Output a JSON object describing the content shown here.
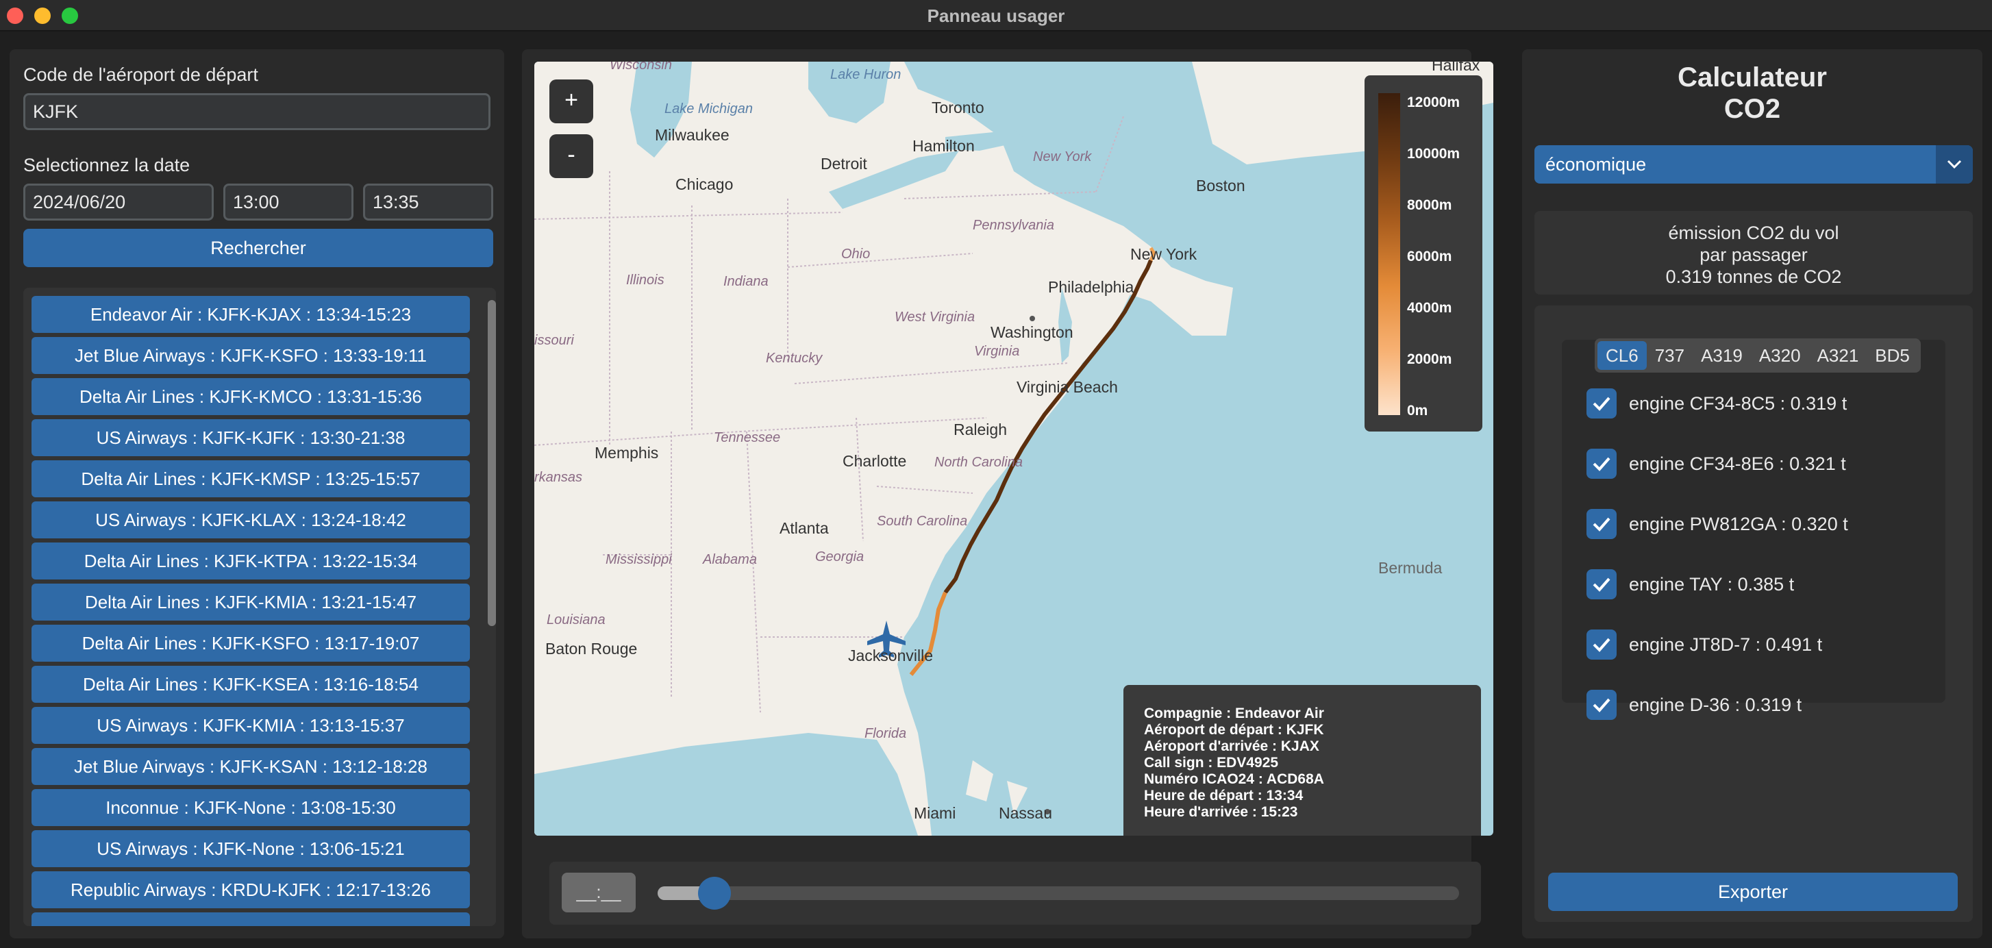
{
  "window": {
    "title": "Panneau usager"
  },
  "search": {
    "airport_label": "Code de l'aéroport de départ",
    "airport_value": "KJFK",
    "date_label": "Selectionnez la date",
    "date_value": "2024/06/20",
    "time_start": "13:00",
    "time_end": "13:35",
    "search_button": "Rechercher"
  },
  "flights": [
    "Endeavor Air : KJFK-KJAX : 13:34-15:23",
    "Jet Blue Airways : KJFK-KSFO : 13:33-19:11",
    "Delta Air Lines : KJFK-KMCO : 13:31-15:36",
    "US Airways : KJFK-KJFK : 13:30-21:38",
    "Delta Air Lines : KJFK-KMSP : 13:25-15:57",
    "US Airways : KJFK-KLAX : 13:24-18:42",
    "Delta Air Lines : KJFK-KTPA : 13:22-15:34",
    "Delta Air Lines : KJFK-KMIA : 13:21-15:47",
    "Delta Air Lines : KJFK-KSFO : 13:17-19:07",
    "Delta Air Lines : KJFK-KSEA : 13:16-18:54",
    "US Airways : KJFK-KMIA : 13:13-15:37",
    "Jet Blue Airways : KJFK-KSAN : 13:12-18:28",
    "Inconnue : KJFK-None : 13:08-15:30",
    "US Airways : KJFK-None : 13:06-15:21",
    "Republic Airways : KRDU-KJFK : 12:17-13:26"
  ],
  "map": {
    "zoom_in": "+",
    "zoom_out": "-",
    "legend": [
      "12000m",
      "10000m",
      "8000m",
      "6000m",
      "4000m",
      "2000m",
      "0m"
    ],
    "labels": {
      "wisconsin": "Wisconsin",
      "lake_michigan": "Lake Michigan",
      "lake_huron": "Lake Huron",
      "toronto": "Toronto",
      "milwaukee": "Milwaukee",
      "hamilton": "Hamilton",
      "detroit": "Detroit",
      "new_york_state": "New York",
      "chicago": "Chicago",
      "boston": "Boston",
      "halifax": "Halifax",
      "pennsylvania": "Pennsylvania",
      "new_york": "New York",
      "ohio": "Ohio",
      "illinois": "Illinois",
      "indiana": "Indiana",
      "philadelphia": "Philadelphia",
      "west_virginia": "West Virginia",
      "washington": "Washington",
      "issouri": "issouri",
      "kentucky": "Kentucky",
      "virginia": "Virginia",
      "virginia_beach": "Virginia Beach",
      "raleigh": "Raleigh",
      "memphis": "Memphis",
      "tennessee": "Tennessee",
      "charlotte": "Charlotte",
      "north_carolina": "North Carolina",
      "rkansas": "rkansas",
      "atlanta": "Atlanta",
      "south_carolina": "South Carolina",
      "mississippi": "Mississippi",
      "alabama": "Alabama",
      "georgia": "Georgia",
      "bermuda": "Bermuda",
      "louisiana": "Louisiana",
      "baton_rouge": "Baton Rouge",
      "jacksonville": "Jacksonville",
      "florida": "Florida",
      "miami": "Miami",
      "nassau": "Nassau"
    },
    "info": [
      "Compagnie : Endeavor Air",
      "Aéroport de départ : KJFK",
      "Aéroport d'arrivée : KJAX",
      "Call sign : EDV4925",
      "Numéro ICAO24 : ACD68A",
      "Heure de départ : 13:34",
      "Heure d'arrivée : 15:23"
    ]
  },
  "timeline": {
    "time_display": "__:__",
    "progress": 0.05
  },
  "co2": {
    "title_line1": "Calculateur",
    "title_line2": "CO2",
    "class_selected": "économique",
    "emission_line1": "émission CO2 du vol",
    "emission_line2": "par passager",
    "emission_line3": "0.319 tonnes de CO2",
    "tabs": [
      "CL6",
      "737",
      "A319",
      "A320",
      "A321",
      "BD5"
    ],
    "active_tab": "CL6",
    "engines": [
      "engine CF34-8C5 : 0.319 t",
      "engine CF34-8E6 : 0.321 t",
      "engine PW812GA : 0.320 t",
      "engine TAY : 0.385 t",
      "engine JT8D-7 : 0.491 t",
      "engine D-36 : 0.319 t"
    ],
    "export_button": "Exporter"
  },
  "colors": {
    "accent": "#2f6aa7",
    "panel": "#2a2a2a",
    "background": "#1f1f1f"
  }
}
